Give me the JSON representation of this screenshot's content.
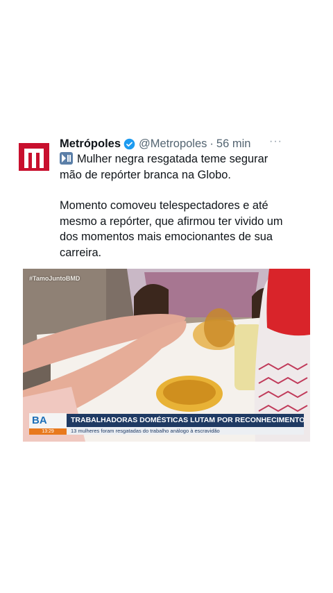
{
  "author": {
    "name": "Metrópoles",
    "handle": "@Metropoles",
    "separator": "·",
    "time": "56 min",
    "verified": true,
    "logo_color": "#c8102e"
  },
  "more_label": "···",
  "tweet": {
    "line1": "Mulher negra resgatada teme segurar mão de repórter branca na Globo.",
    "line2": "Momento comoveu telespectadores e até mesmo a repórter, que afirmou ter vivido um dos momentos mais emocionantes de sua carreira."
  },
  "media": {
    "hashtag": "#TamoJuntoBMD",
    "bug": "BA",
    "clock": "13:29",
    "headline": "TRABALHADORAS DOMÉSTICAS LUTAM POR RECONHECIMENTO",
    "subheadline": "13 mulheres foram resgatadas do trabalho análogo à escravidão"
  },
  "colors": {
    "verified_blue": "#1d9bf0",
    "muted_text": "#536471"
  }
}
